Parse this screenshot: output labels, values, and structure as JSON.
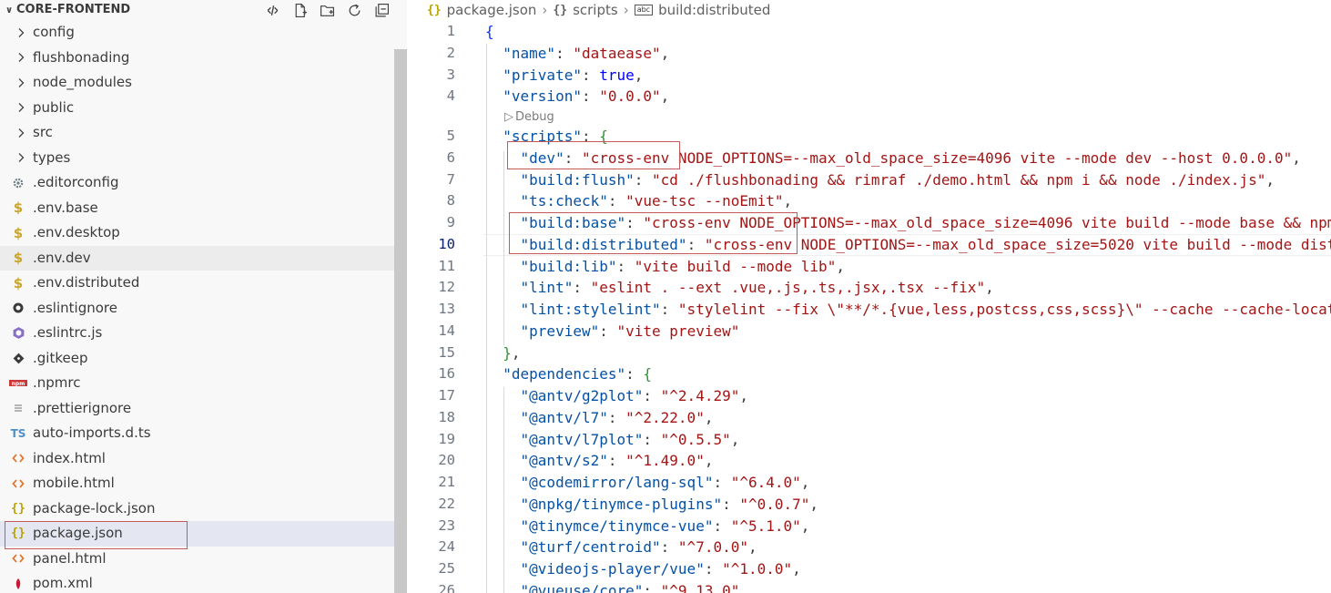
{
  "explorer": {
    "title": "CORE-FRONTEND",
    "actions": [
      {
        "name": "source-control-icon"
      },
      {
        "name": "new-file-icon"
      },
      {
        "name": "new-folder-icon"
      },
      {
        "name": "refresh-icon"
      },
      {
        "name": "collapse-all-icon"
      }
    ],
    "items": [
      {
        "label": "config",
        "type": "folder",
        "icon": "chevron-right-icon"
      },
      {
        "label": "flushbonading",
        "type": "folder",
        "icon": "chevron-right-icon"
      },
      {
        "label": "node_modules",
        "type": "folder",
        "icon": "chevron-right-icon"
      },
      {
        "label": "public",
        "type": "folder",
        "icon": "chevron-right-icon"
      },
      {
        "label": "src",
        "type": "folder",
        "icon": "chevron-right-icon"
      },
      {
        "label": "types",
        "type": "folder",
        "icon": "chevron-right-icon"
      },
      {
        "label": ".editorconfig",
        "type": "file",
        "icon": "gear-icon",
        "color": "#6d8086"
      },
      {
        "label": ".env.base",
        "type": "file",
        "icon": "dollar-icon",
        "glyph": "$",
        "color": "#c9a52b"
      },
      {
        "label": ".env.desktop",
        "type": "file",
        "icon": "dollar-icon",
        "glyph": "$",
        "color": "#c9a52b"
      },
      {
        "label": ".env.dev",
        "type": "file",
        "icon": "dollar-icon",
        "glyph": "$",
        "color": "#c9a52b",
        "state": "hover"
      },
      {
        "label": ".env.distributed",
        "type": "file",
        "icon": "dollar-icon",
        "glyph": "$",
        "color": "#c9a52b"
      },
      {
        "label": ".eslintignore",
        "type": "file",
        "icon": "eslint-ignore-icon",
        "color": "#3b3b3b"
      },
      {
        "label": ".eslintrc.js",
        "type": "file",
        "icon": "eslint-icon",
        "color": "#8a6fc9"
      },
      {
        "label": ".gitkeep",
        "type": "file",
        "icon": "git-icon",
        "color": "#3b3b3b"
      },
      {
        "label": ".npmrc",
        "type": "file",
        "icon": "npm-icon",
        "glyph": "npm",
        "color": "#cb3837"
      },
      {
        "label": ".prettierignore",
        "type": "file",
        "icon": "lines-icon",
        "color": "#8a8a8a"
      },
      {
        "label": "auto-imports.d.ts",
        "type": "file",
        "icon": "typescript-icon",
        "glyph": "TS",
        "color": "#4d8fc9"
      },
      {
        "label": "index.html",
        "type": "file",
        "icon": "html-icon",
        "glyph": "<>",
        "color": "#e37933"
      },
      {
        "label": "mobile.html",
        "type": "file",
        "icon": "html-icon",
        "glyph": "<>",
        "color": "#e37933"
      },
      {
        "label": "package-lock.json",
        "type": "file",
        "icon": "json-icon",
        "glyph": "{}",
        "color": "#b8a200"
      },
      {
        "label": "package.json",
        "type": "file",
        "icon": "json-icon",
        "glyph": "{}",
        "color": "#b8a200",
        "state": "selected"
      },
      {
        "label": "panel.html",
        "type": "file",
        "icon": "html-icon",
        "glyph": "<>",
        "color": "#e37933"
      },
      {
        "label": "pom.xml",
        "type": "file",
        "icon": "maven-icon",
        "color": "#c71a36"
      }
    ]
  },
  "breadcrumb": {
    "file": "package.json",
    "file_icon": "{}",
    "section_icon": "{}",
    "section": "scripts",
    "item_icon": "abc",
    "item": "build:distributed"
  },
  "editor": {
    "codelens": "Debug",
    "current_line": 10,
    "lines": [
      {
        "n": "1",
        "tokens": [
          [
            "br1",
            "{"
          ]
        ]
      },
      {
        "n": "2",
        "tokens": [
          [
            "p",
            "  "
          ],
          [
            "k",
            "\"name\""
          ],
          [
            "p",
            ": "
          ],
          [
            "s",
            "\"dataease\""
          ],
          [
            "p",
            ","
          ]
        ]
      },
      {
        "n": "3",
        "tokens": [
          [
            "p",
            "  "
          ],
          [
            "k",
            "\"private\""
          ],
          [
            "p",
            ": "
          ],
          [
            "b",
            "true"
          ],
          [
            "p",
            ","
          ]
        ]
      },
      {
        "n": "4",
        "tokens": [
          [
            "p",
            "  "
          ],
          [
            "k",
            "\"version\""
          ],
          [
            "p",
            ": "
          ],
          [
            "s",
            "\"0.0.0\""
          ],
          [
            "p",
            ","
          ]
        ]
      },
      {
        "n": "5",
        "tokens": [
          [
            "p",
            "  "
          ],
          [
            "k",
            "\"scripts\""
          ],
          [
            "p",
            ": "
          ],
          [
            "br2",
            "{"
          ]
        ]
      },
      {
        "n": "6",
        "tokens": [
          [
            "p",
            "    "
          ],
          [
            "k",
            "\"dev\""
          ],
          [
            "p",
            ": "
          ],
          [
            "s",
            "\"cross-env NODE_OPTIONS=--max_old_space_size=4096 vite --mode dev --host 0.0.0.0\""
          ],
          [
            "p",
            ","
          ]
        ]
      },
      {
        "n": "7",
        "tokens": [
          [
            "p",
            "    "
          ],
          [
            "k",
            "\"build:flush\""
          ],
          [
            "p",
            ": "
          ],
          [
            "s",
            "\"cd ./flushbonading && rimraf ./demo.html && npm i && node ./index.js\""
          ],
          [
            "p",
            ","
          ]
        ]
      },
      {
        "n": "8",
        "tokens": [
          [
            "p",
            "    "
          ],
          [
            "k",
            "\"ts:check\""
          ],
          [
            "p",
            ": "
          ],
          [
            "s",
            "\"vue-tsc --noEmit\""
          ],
          [
            "p",
            ","
          ]
        ]
      },
      {
        "n": "9",
        "tokens": [
          [
            "p",
            "    "
          ],
          [
            "k",
            "\"build:base\""
          ],
          [
            "p",
            ": "
          ],
          [
            "s",
            "\"cross-env NODE_OPTIONS=--max_old_space_size=4096 vite build --mode base && npm"
          ]
        ]
      },
      {
        "n": "10",
        "tokens": [
          [
            "p",
            "    "
          ],
          [
            "k",
            "\"build:distributed\""
          ],
          [
            "p",
            ": "
          ],
          [
            "s",
            "\"cross-env NODE_OPTIONS=--max_old_space_size=5020 vite build --mode dist"
          ]
        ]
      },
      {
        "n": "11",
        "tokens": [
          [
            "p",
            "    "
          ],
          [
            "k",
            "\"build:lib\""
          ],
          [
            "p",
            ": "
          ],
          [
            "s",
            "\"vite build --mode lib\""
          ],
          [
            "p",
            ","
          ]
        ]
      },
      {
        "n": "12",
        "tokens": [
          [
            "p",
            "    "
          ],
          [
            "k",
            "\"lint\""
          ],
          [
            "p",
            ": "
          ],
          [
            "s",
            "\"eslint . --ext .vue,.js,.ts,.jsx,.tsx --fix\""
          ],
          [
            "p",
            ","
          ]
        ]
      },
      {
        "n": "13",
        "tokens": [
          [
            "p",
            "    "
          ],
          [
            "k",
            "\"lint:stylelint\""
          ],
          [
            "p",
            ": "
          ],
          [
            "s",
            "\"stylelint --fix \\\"**/*.{vue,less,postcss,css,scss}\\\" --cache --cache-locat"
          ]
        ]
      },
      {
        "n": "14",
        "tokens": [
          [
            "p",
            "    "
          ],
          [
            "k",
            "\"preview\""
          ],
          [
            "p",
            ": "
          ],
          [
            "s",
            "\"vite preview\""
          ]
        ]
      },
      {
        "n": "15",
        "tokens": [
          [
            "p",
            "  "
          ],
          [
            "br2",
            "}"
          ],
          [
            "p",
            ","
          ]
        ]
      },
      {
        "n": "16",
        "tokens": [
          [
            "p",
            "  "
          ],
          [
            "k",
            "\"dependencies\""
          ],
          [
            "p",
            ": "
          ],
          [
            "br2",
            "{"
          ]
        ]
      },
      {
        "n": "17",
        "tokens": [
          [
            "p",
            "    "
          ],
          [
            "k",
            "\"@antv/g2plot\""
          ],
          [
            "p",
            ": "
          ],
          [
            "s",
            "\"^2.4.29\""
          ],
          [
            "p",
            ","
          ]
        ]
      },
      {
        "n": "18",
        "tokens": [
          [
            "p",
            "    "
          ],
          [
            "k",
            "\"@antv/l7\""
          ],
          [
            "p",
            ": "
          ],
          [
            "s",
            "\"^2.22.0\""
          ],
          [
            "p",
            ","
          ]
        ]
      },
      {
        "n": "19",
        "tokens": [
          [
            "p",
            "    "
          ],
          [
            "k",
            "\"@antv/l7plot\""
          ],
          [
            "p",
            ": "
          ],
          [
            "s",
            "\"^0.5.5\""
          ],
          [
            "p",
            ","
          ]
        ]
      },
      {
        "n": "20",
        "tokens": [
          [
            "p",
            "    "
          ],
          [
            "k",
            "\"@antv/s2\""
          ],
          [
            "p",
            ": "
          ],
          [
            "s",
            "\"^1.49.0\""
          ],
          [
            "p",
            ","
          ]
        ]
      },
      {
        "n": "21",
        "tokens": [
          [
            "p",
            "    "
          ],
          [
            "k",
            "\"@codemirror/lang-sql\""
          ],
          [
            "p",
            ": "
          ],
          [
            "s",
            "\"^6.4.0\""
          ],
          [
            "p",
            ","
          ]
        ]
      },
      {
        "n": "22",
        "tokens": [
          [
            "p",
            "    "
          ],
          [
            "k",
            "\"@npkg/tinymce-plugins\""
          ],
          [
            "p",
            ": "
          ],
          [
            "s",
            "\"^0.0.7\""
          ],
          [
            "p",
            ","
          ]
        ]
      },
      {
        "n": "23",
        "tokens": [
          [
            "p",
            "    "
          ],
          [
            "k",
            "\"@tinymce/tinymce-vue\""
          ],
          [
            "p",
            ": "
          ],
          [
            "s",
            "\"^5.1.0\""
          ],
          [
            "p",
            ","
          ]
        ]
      },
      {
        "n": "24",
        "tokens": [
          [
            "p",
            "    "
          ],
          [
            "k",
            "\"@turf/centroid\""
          ],
          [
            "p",
            ": "
          ],
          [
            "s",
            "\"^7.0.0\""
          ],
          [
            "p",
            ","
          ]
        ]
      },
      {
        "n": "25",
        "tokens": [
          [
            "p",
            "    "
          ],
          [
            "k",
            "\"@videojs-player/vue\""
          ],
          [
            "p",
            ": "
          ],
          [
            "s",
            "\"^1.0.0\""
          ],
          [
            "p",
            ","
          ]
        ]
      },
      {
        "n": "26",
        "tokens": [
          [
            "p",
            "    "
          ],
          [
            "k",
            "\"@vueuse/core\""
          ],
          [
            "p",
            ": "
          ],
          [
            "s",
            "\"^9.13.0\""
          ],
          [
            "p",
            ","
          ]
        ]
      }
    ]
  }
}
